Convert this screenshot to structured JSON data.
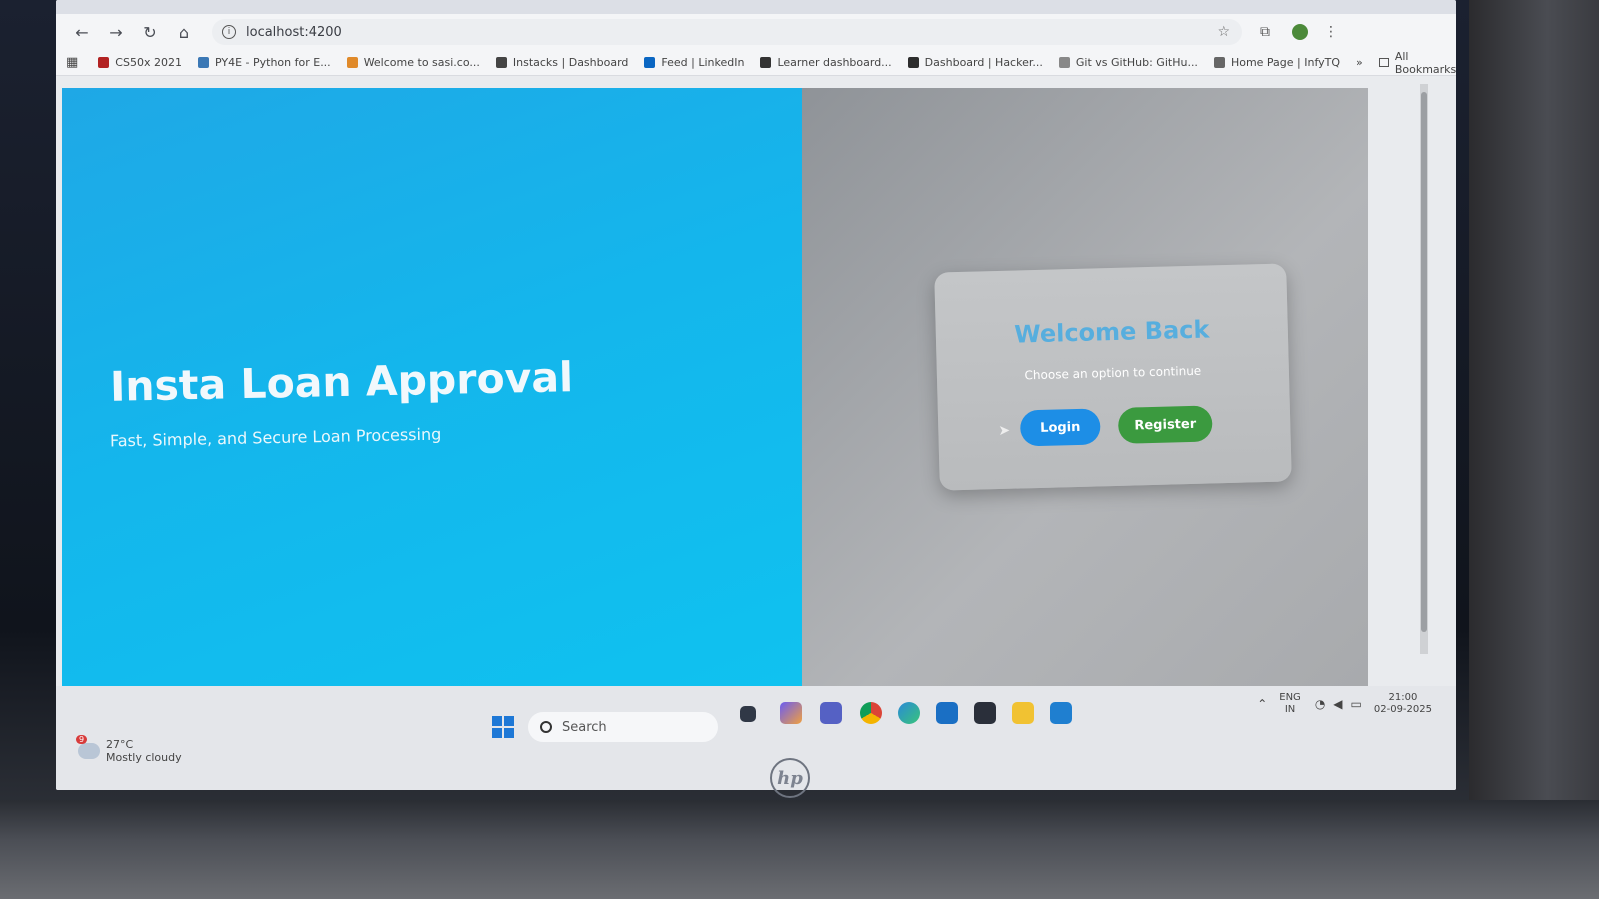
{
  "browser": {
    "url": "localhost:4200",
    "bookmarks": [
      {
        "label": "CS50x 2021",
        "color": "#b22222"
      },
      {
        "label": "PY4E - Python for E...",
        "color": "#3b78b5"
      },
      {
        "label": "Welcome to sasi.co...",
        "color": "#e08a2a"
      },
      {
        "label": "Instacks | Dashboard",
        "color": "#444444"
      },
      {
        "label": "Feed | LinkedIn",
        "color": "#0a66c2"
      },
      {
        "label": "Learner dashboard...",
        "color": "#333333"
      },
      {
        "label": "Dashboard | Hacker...",
        "color": "#2d2d2d"
      },
      {
        "label": "Git vs GitHub: GitHu...",
        "color": "#888888"
      },
      {
        "label": "Home Page | InfyTQ",
        "color": "#666666"
      }
    ],
    "more_label": "»",
    "all_bookmarks_label": "All Bookmarks"
  },
  "hero": {
    "title": "Insta Loan Approval",
    "subtitle": "Fast, Simple, and Secure Loan Processing"
  },
  "auth_card": {
    "title": "Welcome Back",
    "subtitle": "Choose an option to continue",
    "login_label": "Login",
    "register_label": "Register"
  },
  "taskbar": {
    "weather_temp": "27°C",
    "weather_desc": "Mostly cloudy",
    "weather_badge": "9",
    "search_label": "Search",
    "language_top": "ENG",
    "language_bottom": "IN",
    "time": "21:00",
    "date": "02-09-2025"
  },
  "brand": {
    "laptop_logo": "hp"
  },
  "colors": {
    "hero_blue": "#14b6ec",
    "login_blue": "#1d8ee6",
    "register_green": "#3b9a3f",
    "title_blue": "#57aede"
  }
}
